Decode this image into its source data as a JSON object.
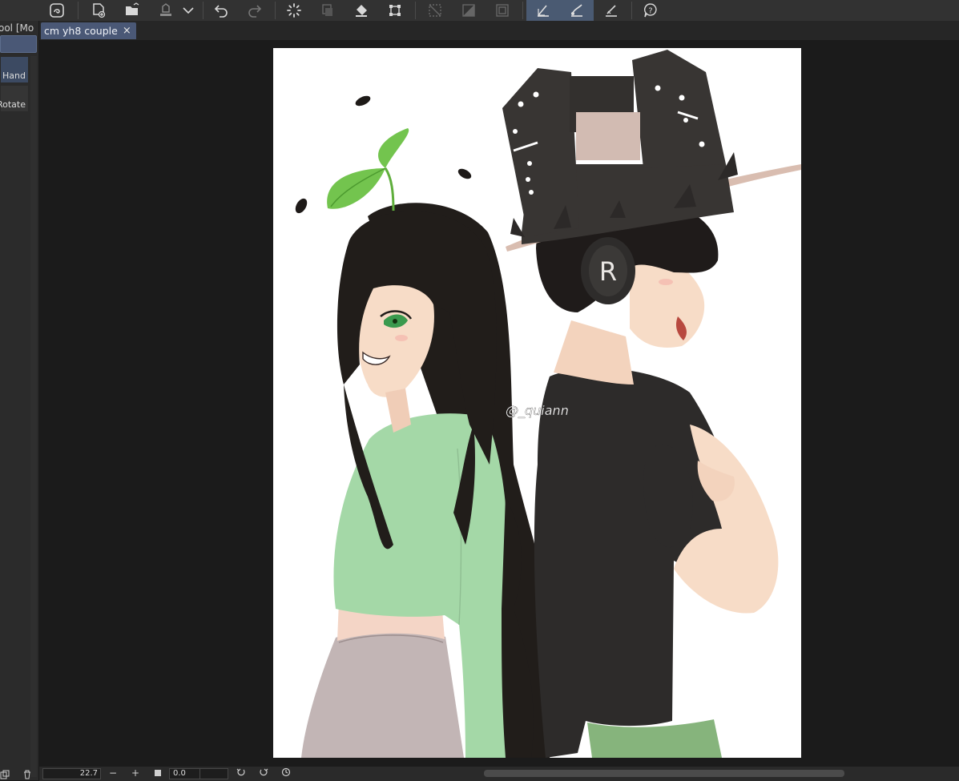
{
  "toolbar": {
    "buttons": [
      "clip-studio-icon",
      "new-file-icon",
      "open-file-icon",
      "save-icon",
      "dropdown-icon",
      "undo-icon",
      "redo-icon",
      "loading-icon",
      "clear-icon",
      "fill-icon",
      "transform-icon",
      "deselect-icon",
      "invert-selection-icon",
      "border-selection-icon",
      "pen-snap-icon",
      "brush-snap-icon",
      "ruler-snap-icon",
      "help-icon"
    ]
  },
  "left_panel": {
    "title": "ool [Mo",
    "items": [
      {
        "label": "Hand",
        "selected": true
      },
      {
        "label": "Rotate",
        "selected": false
      }
    ]
  },
  "tab": {
    "title": "cm yh8 couple",
    "close": "×"
  },
  "artwork": {
    "watermark": "@_quiann",
    "headphone_letter": "R"
  },
  "statusbar": {
    "zoom": "22.7",
    "zoom_out": "−",
    "zoom_in": "+",
    "rotation": "0.0"
  },
  "colors": {
    "accent": "#4a5876",
    "hair": "#211d1a",
    "shirt_green": "#a4d8a7",
    "skirt": "#c2b5b5",
    "skin": "#f7dcc7",
    "black_shirt": "#2d2b2a",
    "hat": "#383533",
    "hat_brim": "#d9bdb0",
    "sprout": "#73c44e"
  }
}
